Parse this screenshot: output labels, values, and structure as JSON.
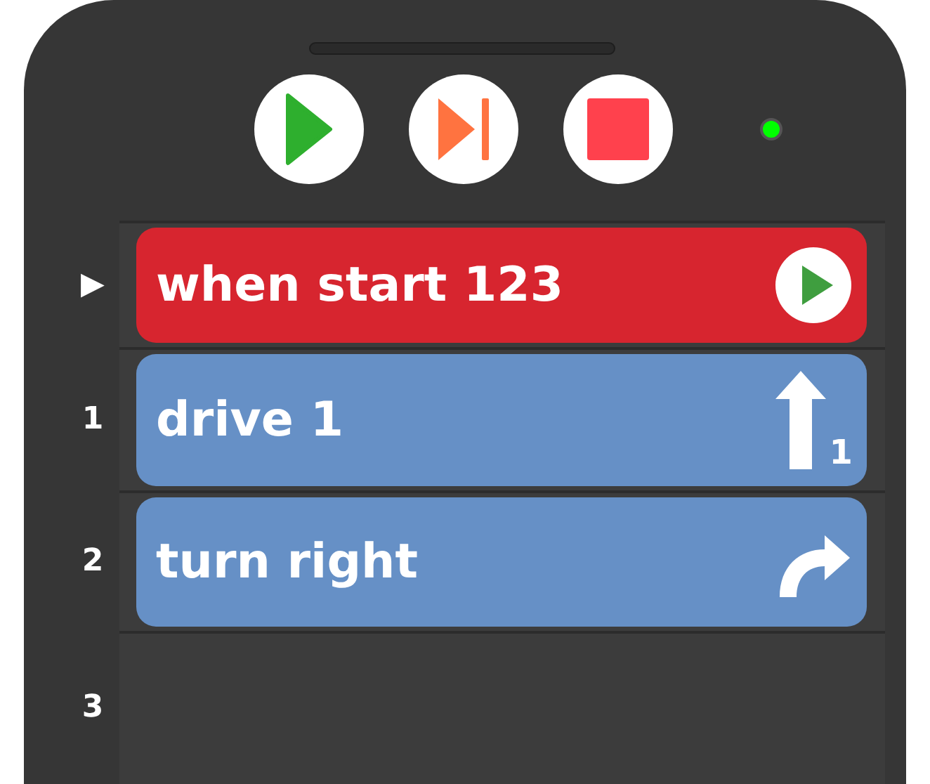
{
  "controls": [
    {
      "kind": "play",
      "color": "#2eaf2e"
    },
    {
      "kind": "step",
      "color": "#ff7340"
    },
    {
      "kind": "stop",
      "color": "#ff414d"
    }
  ],
  "status_light": {
    "color": "#00ff00"
  },
  "program": [
    {
      "label": "▶",
      "block": {
        "kind": "when-start",
        "text": "when start 123",
        "color": "#d7252f"
      }
    },
    {
      "label": "1",
      "block": {
        "kind": "drive",
        "text": "drive 1",
        "color": "#6690c6",
        "icon_label": "1"
      }
    },
    {
      "label": "2",
      "block": {
        "kind": "turn-right",
        "text": "turn right",
        "color": "#6690c6"
      }
    },
    {
      "label": "3"
    }
  ]
}
